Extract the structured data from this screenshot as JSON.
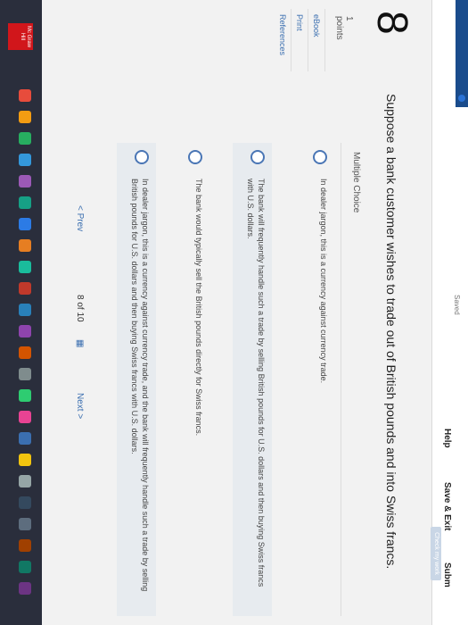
{
  "topbar": {
    "saved": "Saved",
    "help": "Help",
    "save_exit": "Save & Exit",
    "submit": "Subm",
    "check_work": "Check my work"
  },
  "question": {
    "number": "8",
    "points_value": "1",
    "points_label": "points",
    "text": "Suppose a bank customer wishes to trade out of British pounds and into Swiss francs.",
    "type_label": "Multiple Choice"
  },
  "side_links": [
    "eBook",
    "Print",
    "References"
  ],
  "choices": [
    "In dealer jargon, this is a currency against currency trade.",
    "The bank will frequently handle such a trade by selling British pounds for U.S. dollars and then buying Swiss francs with U.S. dollars.",
    "The bank would typically sell the British pounds directly for Swiss francs.",
    "In dealer jargon, this is a currency against currency trade, and the bank will frequently handle such a trade by selling British pounds for U.S. dollars and then buying Swiss francs with U.S. dollars."
  ],
  "pager": {
    "prev": "< Prev",
    "page": "8 of 10",
    "grid_icon": "▦",
    "next": "Next >"
  },
  "logo": {
    "text": "Mc Graw Hill"
  },
  "colors": {
    "accent": "#3b6fb0",
    "radio": "#4a76b5",
    "brand_red": "#d1161b"
  }
}
